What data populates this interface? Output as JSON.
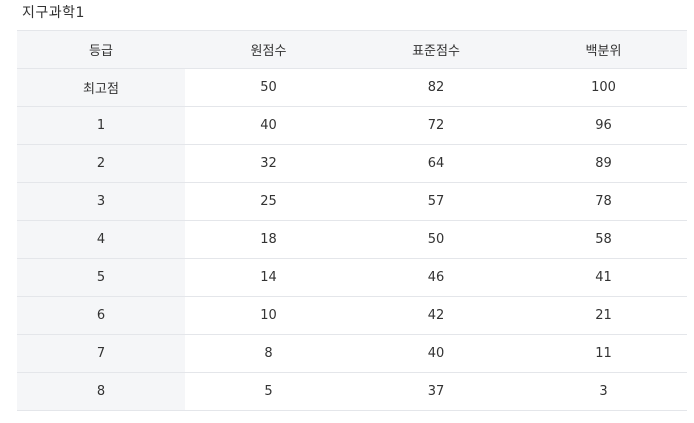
{
  "title": "지구과학1",
  "table": {
    "headers": [
      "등급",
      "원점수",
      "표준점수",
      "백분위"
    ],
    "rows": [
      [
        "최고점",
        "50",
        "82",
        "100"
      ],
      [
        "1",
        "40",
        "72",
        "96"
      ],
      [
        "2",
        "32",
        "64",
        "89"
      ],
      [
        "3",
        "25",
        "57",
        "78"
      ],
      [
        "4",
        "18",
        "50",
        "58"
      ],
      [
        "5",
        "14",
        "46",
        "41"
      ],
      [
        "6",
        "10",
        "42",
        "21"
      ],
      [
        "7",
        "8",
        "40",
        "11"
      ],
      [
        "8",
        "5",
        "37",
        "3"
      ]
    ]
  }
}
